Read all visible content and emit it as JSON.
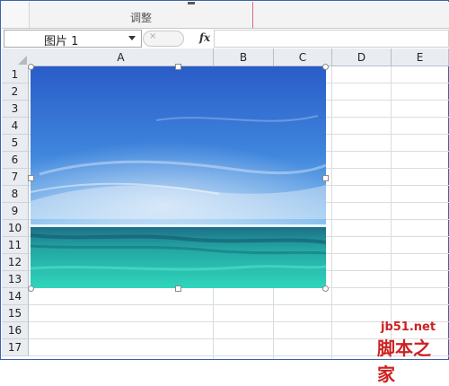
{
  "ribbon": {
    "group_label": "调整"
  },
  "formula_bar": {
    "name_box_value": "图片 1",
    "fx_label": "fx",
    "cancel_glyph": "×",
    "formula_value": ""
  },
  "columns": [
    "A",
    "B",
    "C",
    "D",
    "E"
  ],
  "rows": [
    "1",
    "2",
    "3",
    "4",
    "5",
    "6",
    "7",
    "8",
    "9",
    "10",
    "11",
    "12",
    "13",
    "14",
    "15",
    "16",
    "17"
  ],
  "picture": {
    "subject": "ocean-and-sky-photo",
    "sky_top_color": "#2a5cc8",
    "sky_mid_color": "#5aa0e6",
    "horizon_color": "#ffffff",
    "sea_near_color": "#2fd6bc",
    "sea_far_color": "#1d6f86"
  },
  "watermark": {
    "site": "jb51.net",
    "brand": "脚本之家"
  },
  "colors": {
    "accent_pink": "#d96a8a",
    "window_border": "#3d62a8",
    "header_bg": "#e9ecf1",
    "watermark_red": "#cc2222"
  }
}
